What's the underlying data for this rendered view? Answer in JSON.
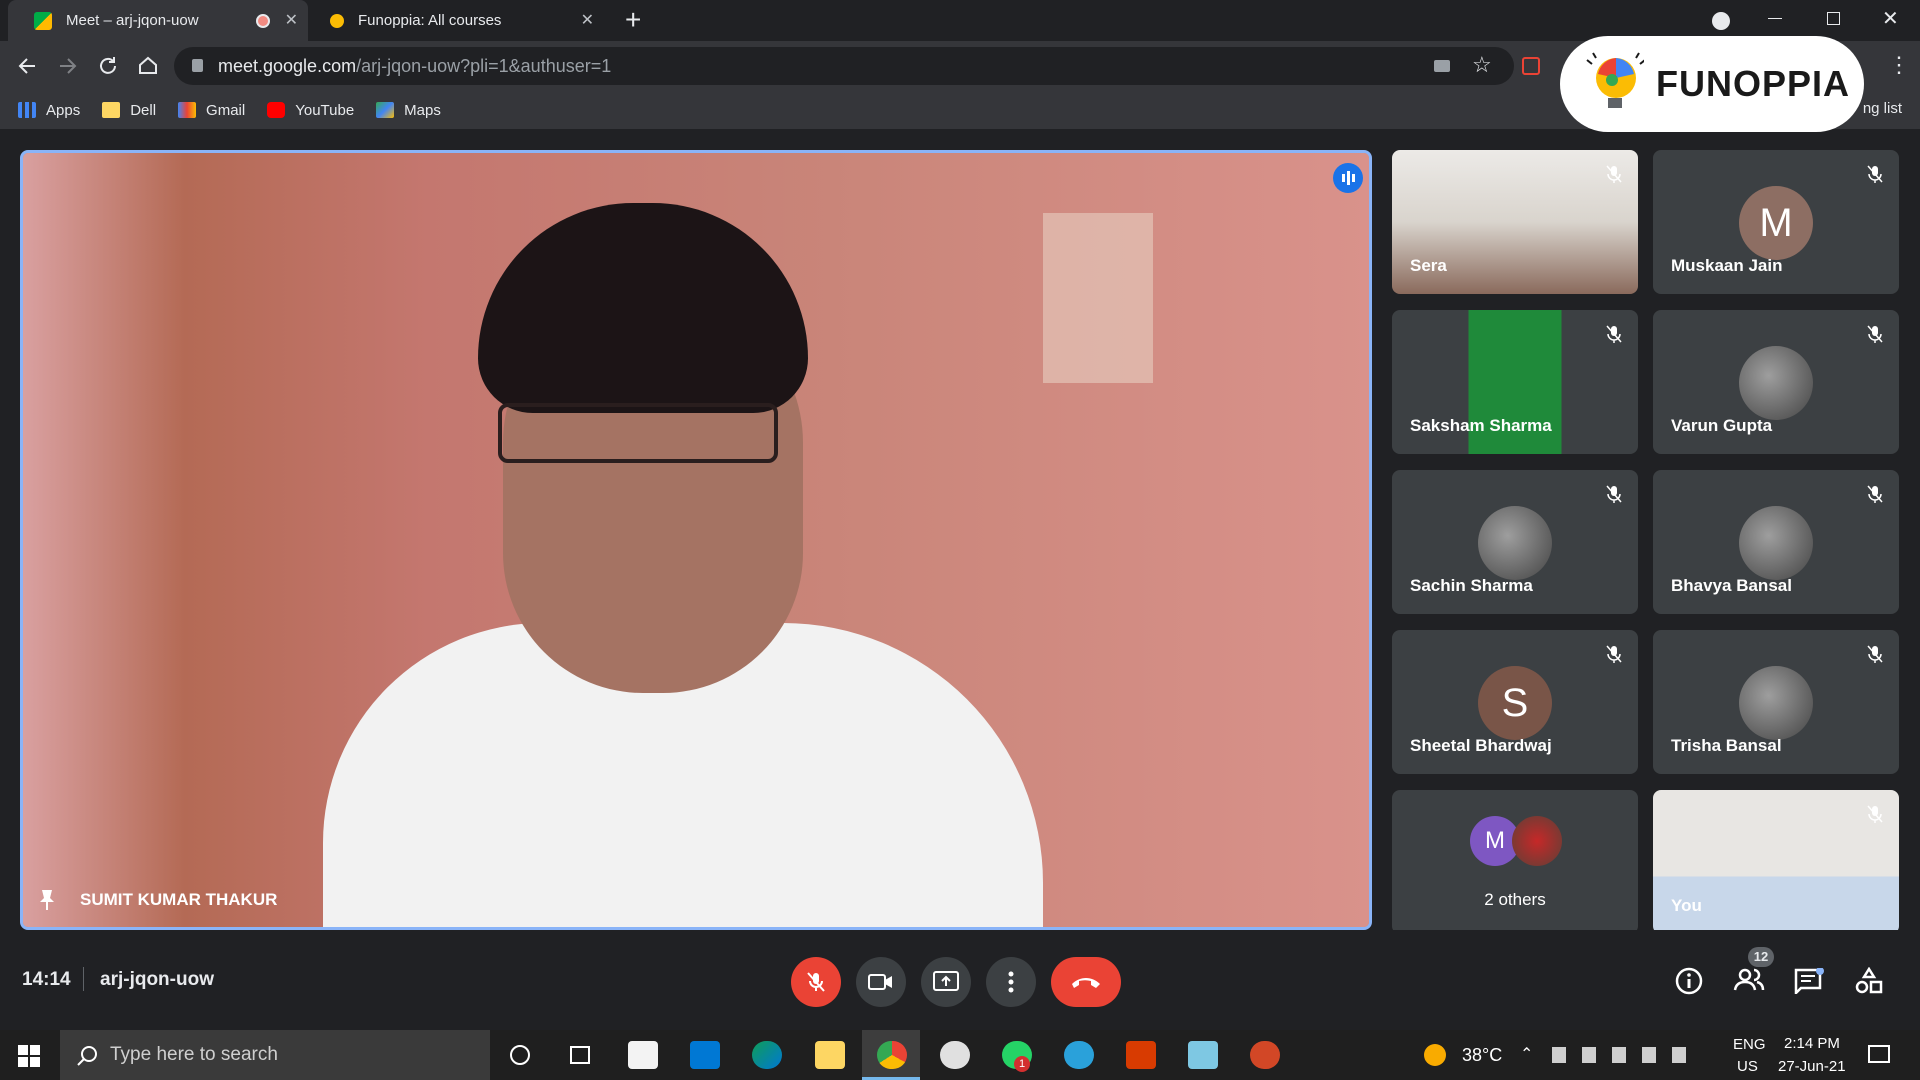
{
  "browser": {
    "tabs": [
      {
        "title": "Meet – arj-jqon-uow",
        "active": true
      },
      {
        "title": "Funoppia: All courses",
        "active": false
      }
    ],
    "new_tab": "+",
    "url_host": "meet.google.com",
    "url_path": "/arj-jqon-uow?pli=1&authuser=1",
    "bookmarks": [
      {
        "label": "Apps",
        "icon": "apps-grid-icon"
      },
      {
        "label": "Dell",
        "icon": "folder-icon"
      },
      {
        "label": "Gmail",
        "icon": "gmail-icon"
      },
      {
        "label": "YouTube",
        "icon": "youtube-icon"
      },
      {
        "label": "Maps",
        "icon": "maps-icon"
      }
    ],
    "reading_list": "ng list"
  },
  "overlay_logo": {
    "text": "FUNOPPIA"
  },
  "meeting": {
    "time": "14:14",
    "code": "arj-jqon-uow",
    "presenter": "SUMIT KUMAR THAKUR",
    "participant_count": "12",
    "participants": [
      {
        "name": "Sera",
        "type": "video"
      },
      {
        "name": "Muskaan Jain",
        "type": "initial",
        "initial": "M",
        "color": "#8d6e63"
      },
      {
        "name": "Saksham Sharma",
        "type": "video"
      },
      {
        "name": "Varun Gupta",
        "type": "photo"
      },
      {
        "name": "Sachin Sharma",
        "type": "photo"
      },
      {
        "name": "Bhavya Bansal",
        "type": "photo"
      },
      {
        "name": "Sheetal Bhardwaj",
        "type": "initial",
        "initial": "S",
        "color": "#795548"
      },
      {
        "name": "Trisha Bansal",
        "type": "photo"
      },
      {
        "name": "2 others",
        "type": "others",
        "initial": "M",
        "color": "#7e57c2"
      },
      {
        "name": "You",
        "type": "video"
      }
    ],
    "accent": "#ea4335"
  },
  "taskbar": {
    "search_placeholder": "Type here to search",
    "weather": "38°C",
    "lang1": "ENG",
    "lang2": "US",
    "clock_time": "2:14 PM",
    "clock_date": "27-Jun-21",
    "whatsapp_badge": "1"
  }
}
